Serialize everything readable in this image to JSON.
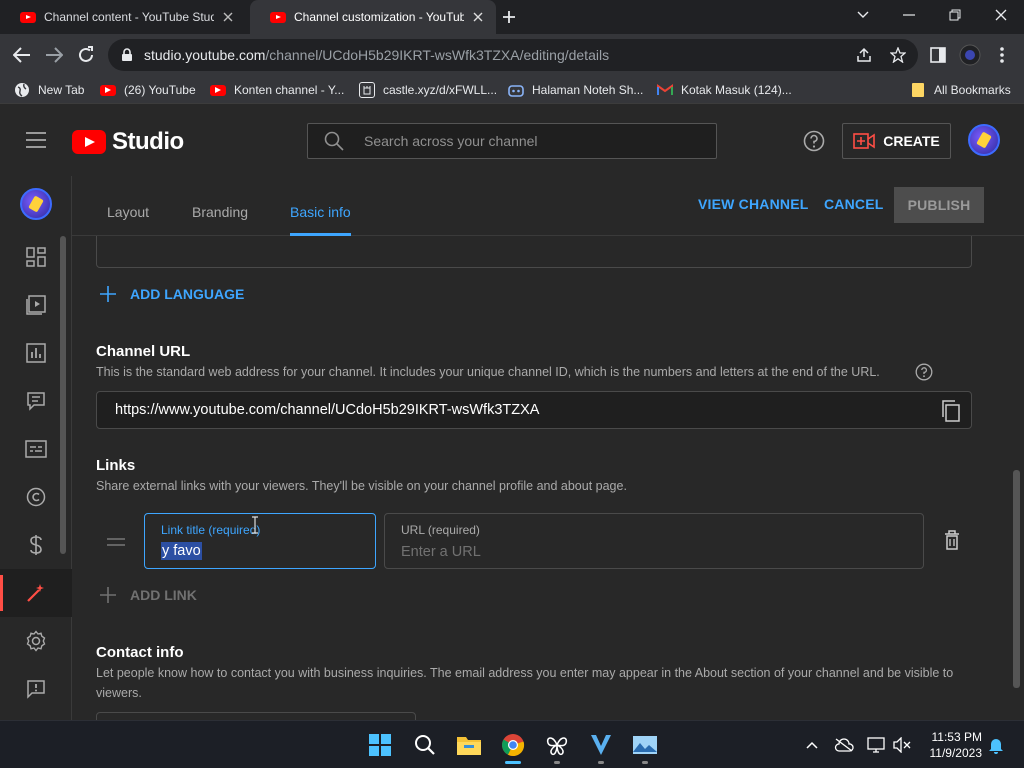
{
  "browser": {
    "tabs": [
      {
        "title": "Channel content - YouTube Studio"
      },
      {
        "title": "Channel customization - YouTube Studio"
      }
    ],
    "url_host": "studio.youtube.com",
    "url_path": "/channel/UCdoH5b29IKRT-wsWfk3TZXA/editing/details",
    "bookmarks": [
      {
        "label": "New Tab"
      },
      {
        "label": "(26) YouTube"
      },
      {
        "label": "Konten channel - Y..."
      },
      {
        "label": "castle.xyz/d/xFWLL..."
      },
      {
        "label": "Halaman Noteh Sh..."
      },
      {
        "label": "Kotak Masuk (124)..."
      },
      {
        "label": "All Bookmarks"
      }
    ]
  },
  "studio": {
    "logo_text": "Studio",
    "search_placeholder": "Search across your channel",
    "create_label": "CREATE"
  },
  "customization": {
    "tabs": [
      "Layout",
      "Branding",
      "Basic info"
    ],
    "active_tab": "Basic info",
    "view_channel": "VIEW CHANNEL",
    "cancel": "CANCEL",
    "publish": "PUBLISH"
  },
  "basic_info": {
    "add_language": "ADD LANGUAGE",
    "channel_url": {
      "title": "Channel URL",
      "description": "This is the standard web address for your channel. It includes your unique channel ID, which is the numbers and letters at the end of the URL.",
      "value": "https://www.youtube.com/channel/UCdoH5b29IKRT-wsWfk3TZXA"
    },
    "links": {
      "title": "Links",
      "description": "Share external links with your viewers. They'll be visible on your channel profile and about page.",
      "link_title_label": "Link title (required)",
      "link_title_value": "y favo",
      "url_label": "URL (required)",
      "url_placeholder": "Enter a URL",
      "add_link": "ADD LINK"
    },
    "contact": {
      "title": "Contact info",
      "description": "Let people know how to contact you with business inquiries. The email address you enter may appear in the About section of your channel and be visible to viewers."
    }
  },
  "taskbar": {
    "time": "11:53 PM",
    "date": "11/9/2023"
  },
  "colors": {
    "accent": "#3ea6ff",
    "brand": "#ff0000",
    "background": "#282828"
  }
}
